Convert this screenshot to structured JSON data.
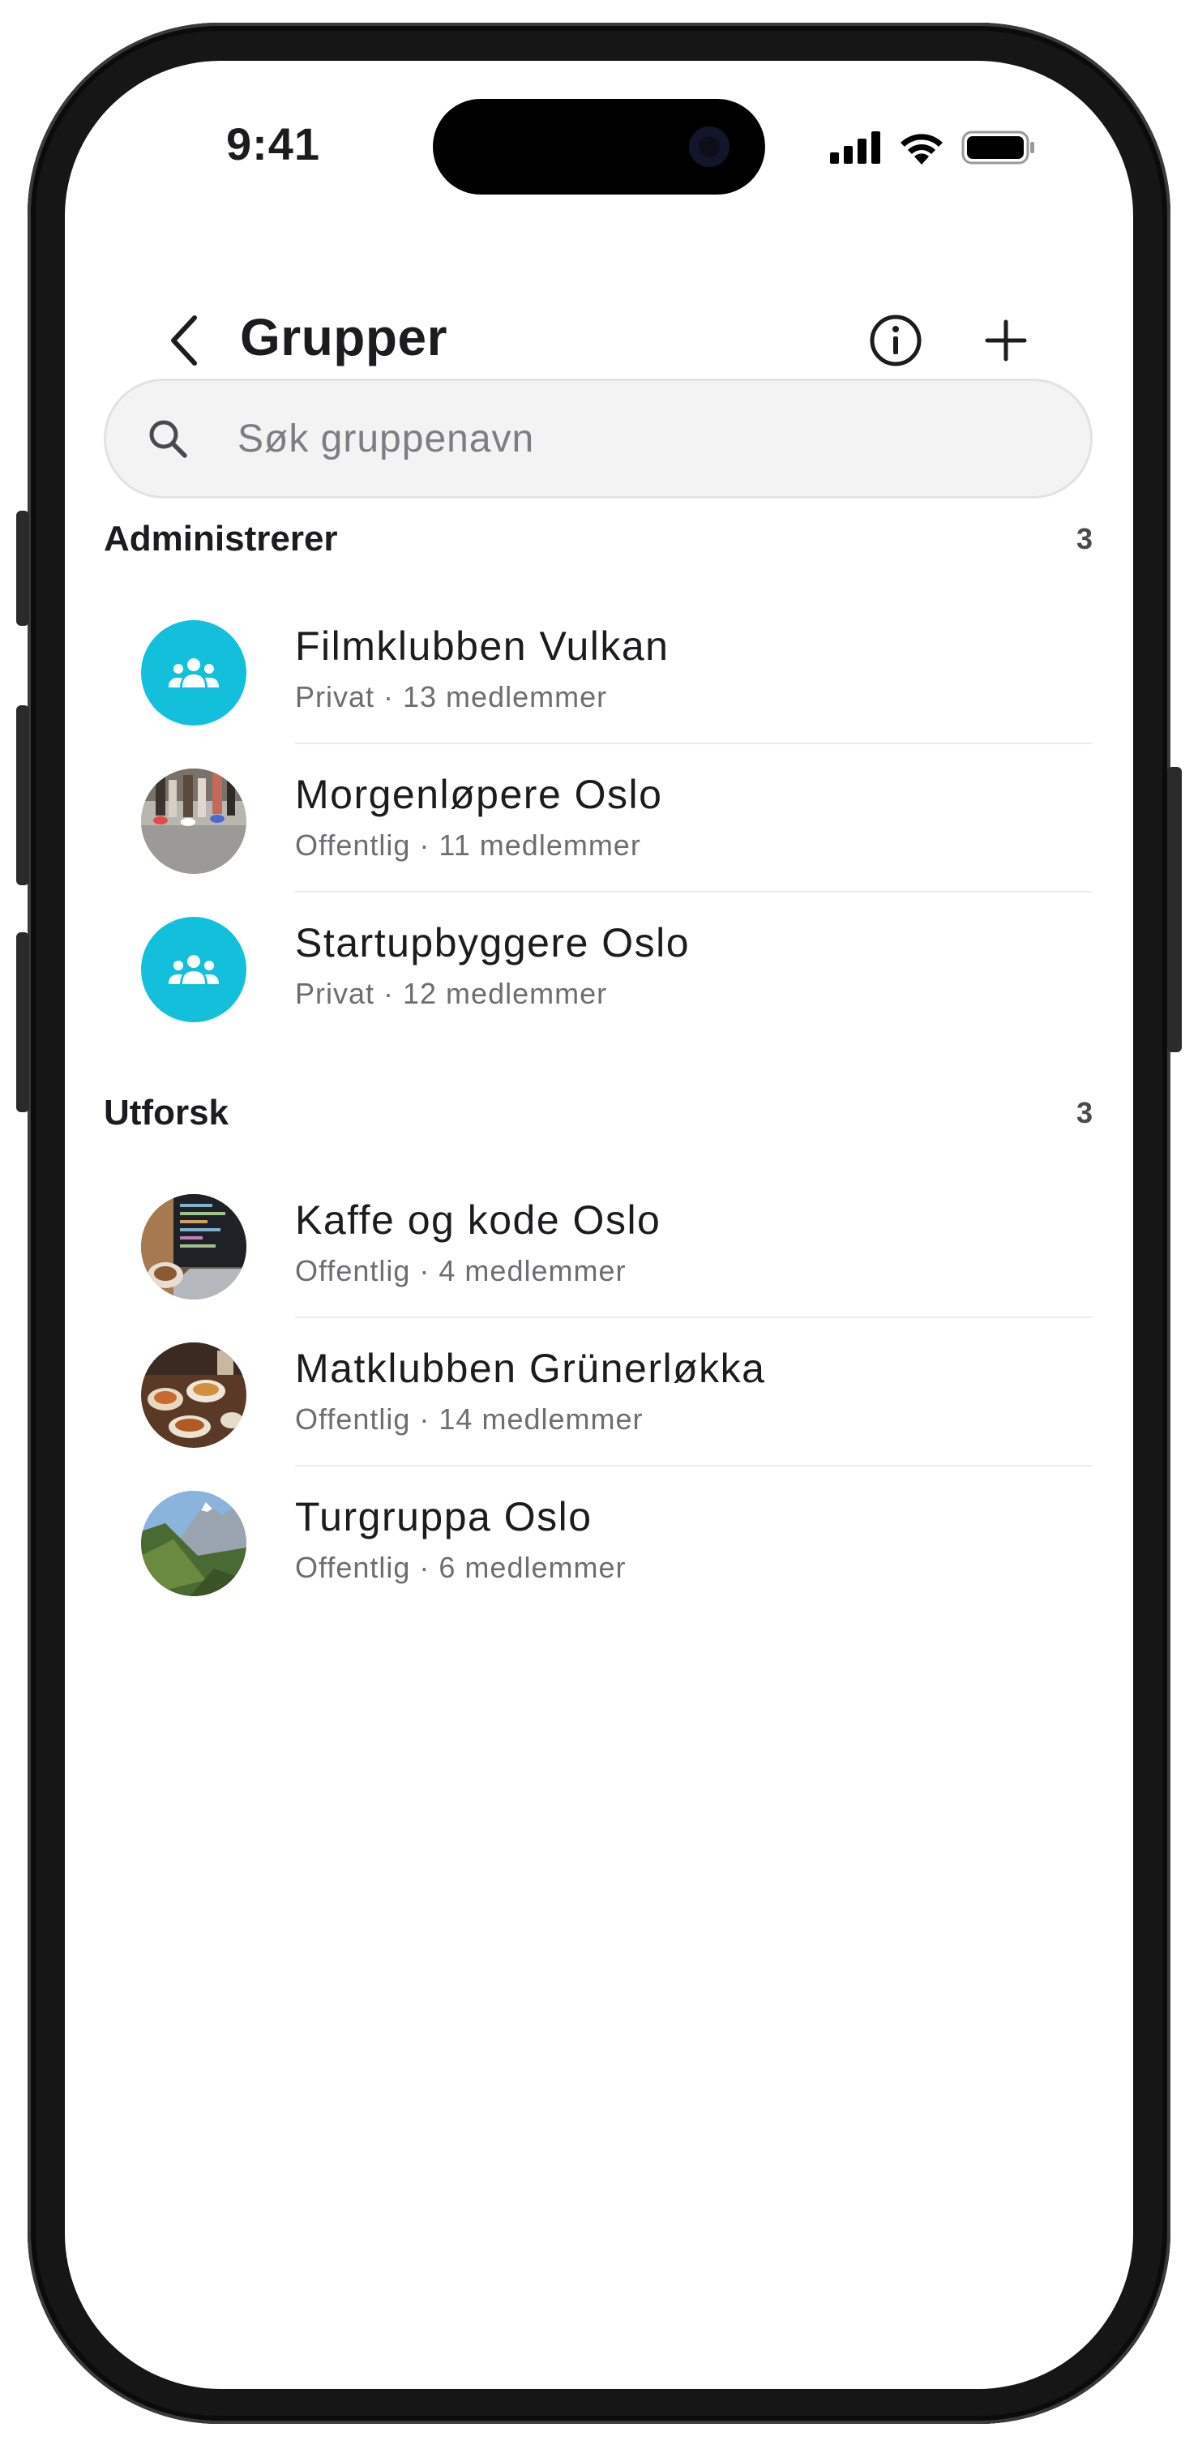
{
  "status_bar": {
    "time": "9:41"
  },
  "header": {
    "title": "Grupper"
  },
  "search": {
    "placeholder": "Søk gruppenavn"
  },
  "sections": [
    {
      "title": "Administrerer",
      "count": "3",
      "groups": [
        {
          "name": "Filmklubben Vulkan",
          "meta": "Privat · 13 medlemmer",
          "avatar": "group-icon"
        },
        {
          "name": "Morgenløpere Oslo",
          "meta": "Offentlig · 11 medlemmer",
          "avatar": "runners-photo"
        },
        {
          "name": "Startupbyggere Oslo",
          "meta": "Privat · 12 medlemmer",
          "avatar": "group-icon"
        }
      ]
    },
    {
      "title": "Utforsk",
      "count": "3",
      "groups": [
        {
          "name": "Kaffe og kode Oslo",
          "meta": "Offentlig · 4 medlemmer",
          "avatar": "laptop-coffee-photo"
        },
        {
          "name": "Matklubben Grünerløkka",
          "meta": "Offentlig · 14 medlemmer",
          "avatar": "food-table-photo"
        },
        {
          "name": "Turgruppa Oslo",
          "meta": "Offentlig · 6 medlemmer",
          "avatar": "mountain-photo"
        }
      ]
    }
  ],
  "colors": {
    "accent": "#12c0dc",
    "text": "#1c1c1e",
    "secondary": "#6d6d72"
  }
}
